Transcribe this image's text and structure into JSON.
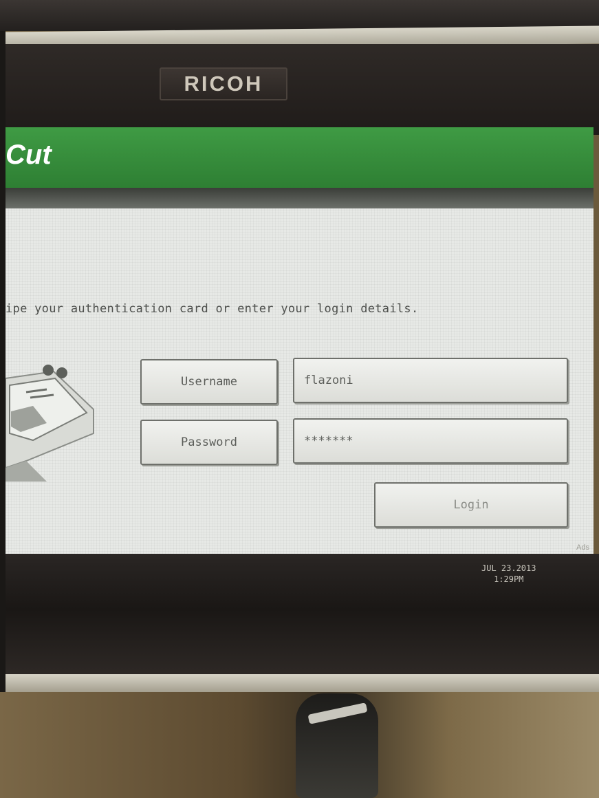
{
  "device": {
    "brand": "RICOH"
  },
  "screen": {
    "app_title": "Cut",
    "instruction": "ipe your authentication card or enter your login details.",
    "username": {
      "label": "Username",
      "value": "flazoni"
    },
    "password": {
      "label": "Password",
      "value": "*******"
    },
    "login_label": "Login",
    "corner_text": "Ads"
  },
  "status": {
    "date": "JUL  23.2013",
    "time": "1:29PM"
  },
  "colors": {
    "header_green": "#3a9140",
    "screen_bg": "#e7e9e6",
    "bezel": "#221e1c"
  },
  "icons": {
    "card_reader": "card-reader-icon"
  }
}
